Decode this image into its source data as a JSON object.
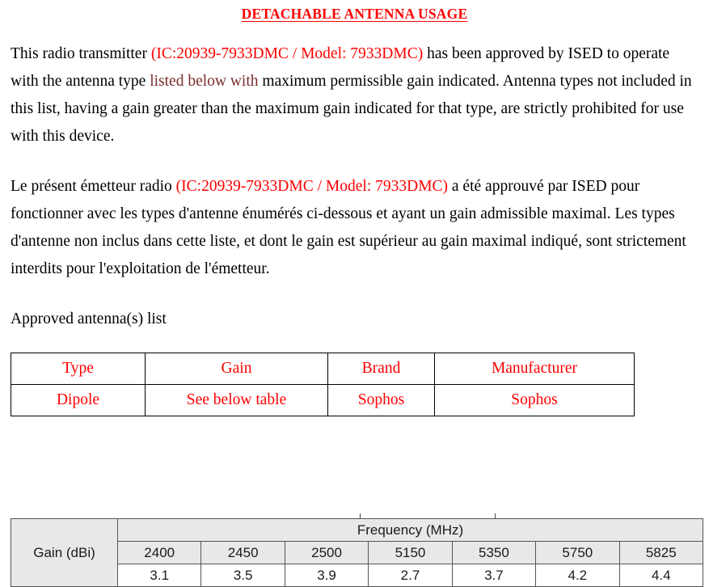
{
  "document": {
    "title": "DETACHABLE ANTENNA USAGE",
    "paragraph_en": {
      "part1": "This radio transmitter ",
      "ic_model": "(IC:20939-7933DMC / Model: 7933DMC)",
      "part2": " has been approved by ISED to operate with the antenna type ",
      "listed_below": "listed below with",
      "part3": " maximum permissible gain indicated. Antenna types not included in this list, having a gain greater than the maximum gain indicated for that type, are strictly prohibited for use with this device."
    },
    "paragraph_fr": {
      "part1": "Le présent émetteur radio ",
      "ic_model": "(IC:20939-7933DMC / Model: 7933DMC)",
      "part2": " a été approuvé par ISED pour fonctionner avec les types d'antenne énumérés ci-dessous et ayant un gain admissible maximal. Les types d'antenne non inclus dans cette liste, et dont le gain est supérieur au gain maximal indiqué, sont strictement interdits pour l'exploitation de l'émetteur."
    },
    "antenna_list_label": "Approved antenna(s) list"
  },
  "antenna_table": {
    "headers": [
      "Type",
      "Gain",
      "Brand",
      "Manufacturer"
    ],
    "rows": [
      [
        "Dipole",
        "See below table",
        "Sophos",
        "Sophos"
      ]
    ]
  },
  "gain_table": {
    "gain_label": "Gain (dBi)",
    "frequency_header": "Frequency (MHz)",
    "frequencies": [
      "2400",
      "2450",
      "2500",
      "5150",
      "5350",
      "5750",
      "5825"
    ],
    "gains": [
      "3.1",
      "3.5",
      "3.9",
      "2.7",
      "3.7",
      "4.2",
      "4.4"
    ]
  },
  "colors": {
    "accent_red": "#ff0000",
    "maroon": "#7b2c2c",
    "header_gray": "#e8e8e8",
    "text_black": "#000000"
  }
}
